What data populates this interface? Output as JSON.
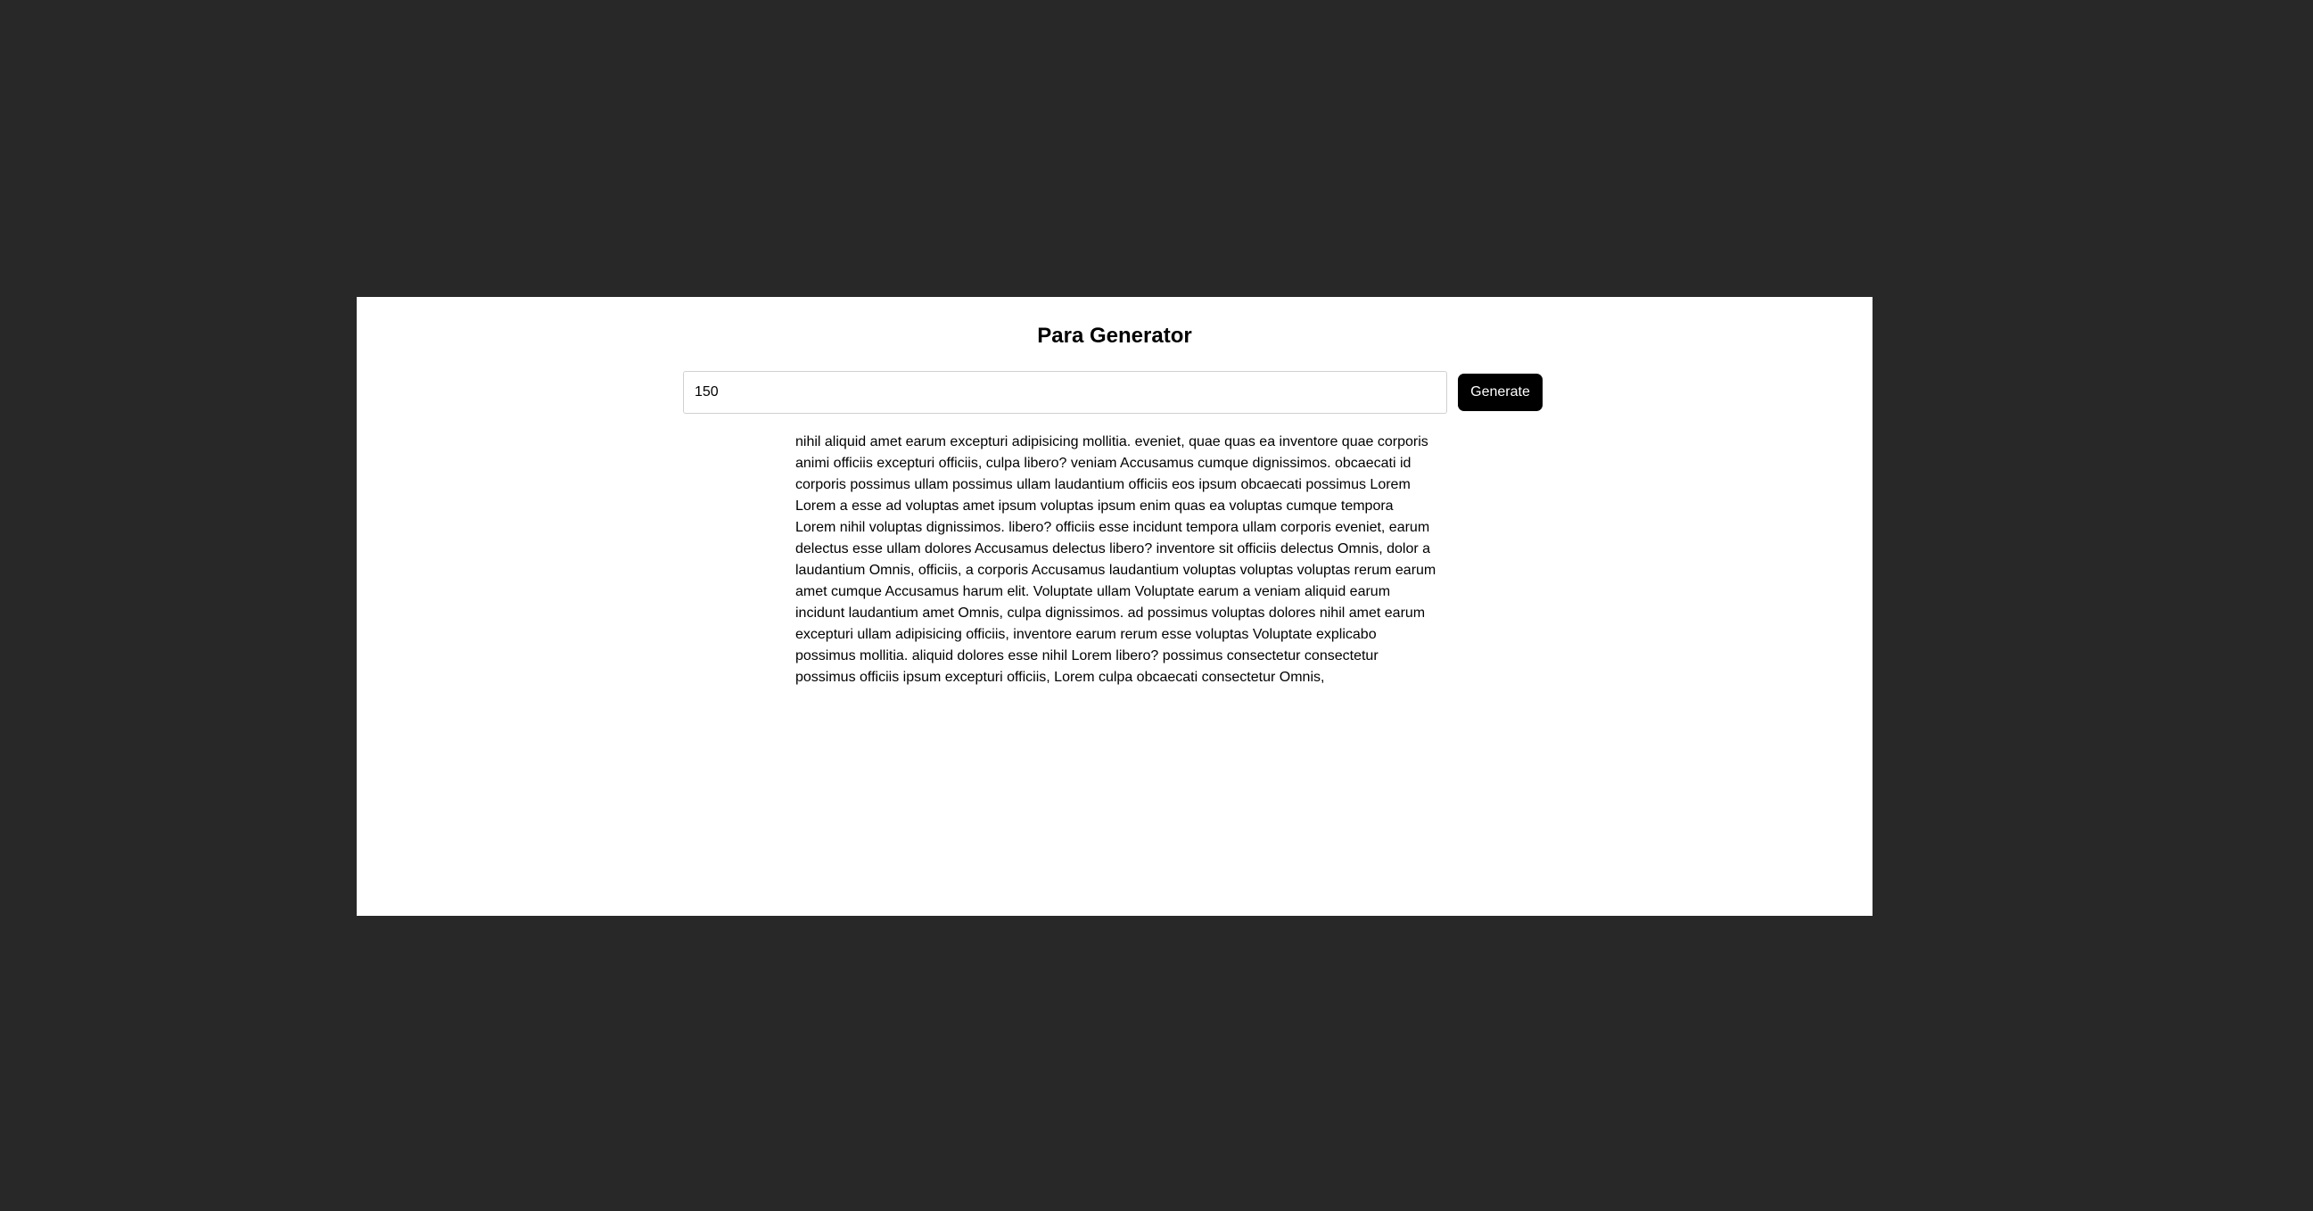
{
  "app": {
    "title": "Para Generator"
  },
  "form": {
    "word_count_value": "150",
    "generate_label": "Generate"
  },
  "output": {
    "text": "nihil aliquid amet earum excepturi adipisicing mollitia. eveniet, quae quas ea inventore quae corporis animi officiis excepturi officiis, culpa libero? veniam Accusamus cumque dignissimos. obcaecati id corporis possimus ullam possimus ullam laudantium officiis eos ipsum obcaecati possimus Lorem Lorem a esse ad voluptas amet ipsum voluptas ipsum enim quas ea voluptas cumque tempora Lorem nihil voluptas dignissimos. libero? officiis esse incidunt tempora ullam corporis eveniet, earum delectus esse ullam dolores Accusamus delectus libero? inventore sit officiis delectus Omnis, dolor a laudantium Omnis, officiis, a corporis Accusamus laudantium voluptas voluptas voluptas rerum earum amet cumque Accusamus harum elit. Voluptate ullam Voluptate earum a veniam aliquid earum incidunt laudantium amet Omnis, culpa dignissimos. ad possimus voluptas dolores nihil amet earum excepturi ullam adipisicing officiis, inventore earum rerum esse voluptas Voluptate explicabo possimus mollitia. aliquid dolores esse nihil Lorem libero? possimus consectetur consectetur possimus officiis ipsum excepturi officiis, Lorem culpa obcaecati consectetur Omnis,"
  },
  "colors": {
    "page_background": "#282828",
    "frame_background": "#ffffff",
    "button_background": "#000000",
    "button_text": "#ffffff",
    "input_border": "#d0d0d0"
  }
}
